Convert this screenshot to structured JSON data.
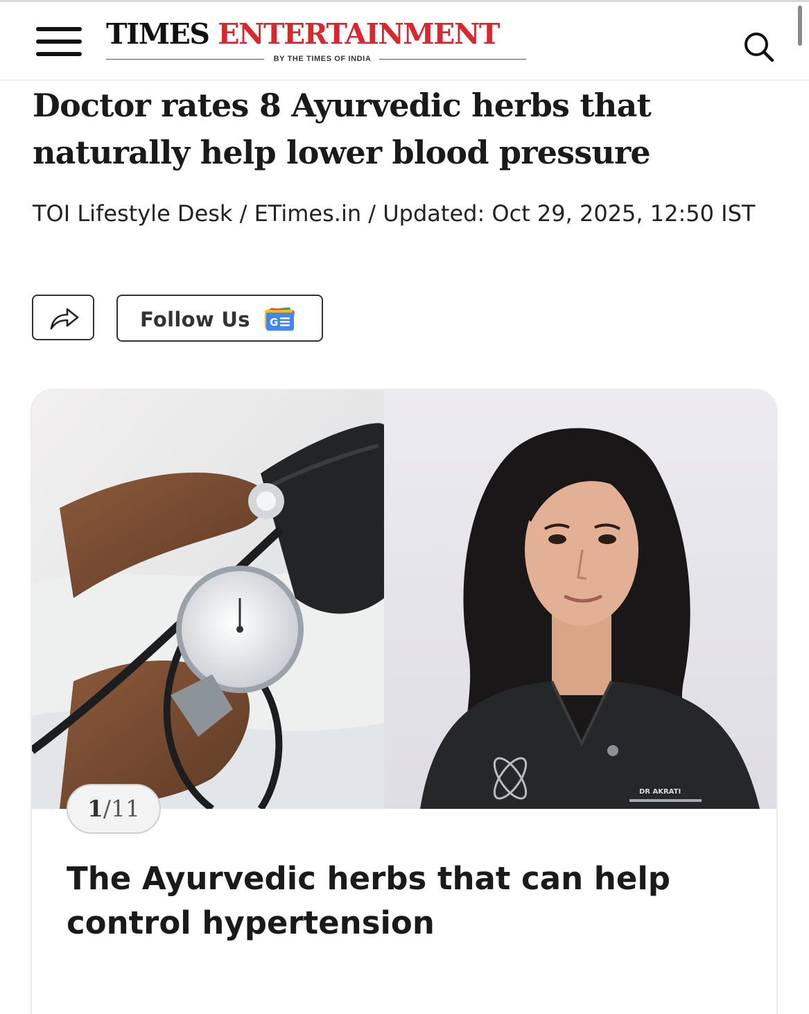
{
  "header": {
    "logo_times": "TIMES",
    "logo_entertainment": "ENTERTAINMENT",
    "logo_tagline": "BY THE TIMES OF INDIA",
    "menu_icon": "hamburger-menu-icon",
    "search_icon": "search-icon",
    "brand_color": "#d7282f"
  },
  "article": {
    "headline": "Doctor rates 8 Ayurvedic herbs that naturally help lower blood pressure",
    "byline": "TOI Lifestyle Desk / ETimes.in / Updated: Oct 29, 2025, 12:50 IST"
  },
  "actions": {
    "share_icon": "share-arrow-icon",
    "follow_label": "Follow Us",
    "follow_icon": "google-news-icon"
  },
  "slideshow": {
    "image_left": "blood-pressure-monitor-photo",
    "image_right": "doctor-portrait-photo",
    "badge_text": "DR AKRATI",
    "counter_current": "1",
    "counter_separator": "/",
    "counter_total": "11",
    "slide_title": "The Ayurvedic herbs that can help control hypertension"
  }
}
